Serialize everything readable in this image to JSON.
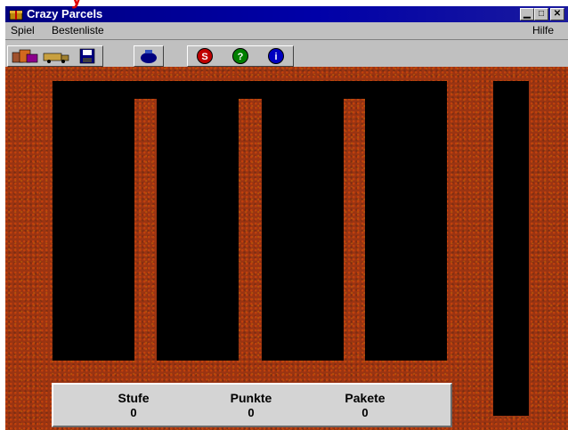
{
  "window": {
    "title": "Crazy Parcels",
    "overlay_text": "y"
  },
  "menu": {
    "spiel": "Spiel",
    "bestenliste": "Bestenliste",
    "hilfe": "Hilfe"
  },
  "toolbar": {
    "buttons": [
      {
        "icon": "parcel-stack-icon"
      },
      {
        "icon": "truck-icon"
      },
      {
        "icon": "save-disk-icon"
      },
      {
        "icon": "sound-icon"
      },
      {
        "icon": "s-round-icon",
        "label": "S",
        "color": "#c00000"
      },
      {
        "icon": "help-round-icon",
        "label": "?",
        "color": "#008000"
      },
      {
        "icon": "info-round-icon",
        "label": "i",
        "color": "#0000c0"
      }
    ]
  },
  "status": {
    "stufe_label": "Stufe",
    "stufe_value": "0",
    "punkte_label": "Punkte",
    "punkte_value": "0",
    "pakete_label": "Pakete",
    "pakete_value": "0"
  },
  "colors": {
    "titlebar": "#000080",
    "brick": "#9a3412",
    "slot": "#000000",
    "overlay": "#e00000"
  }
}
